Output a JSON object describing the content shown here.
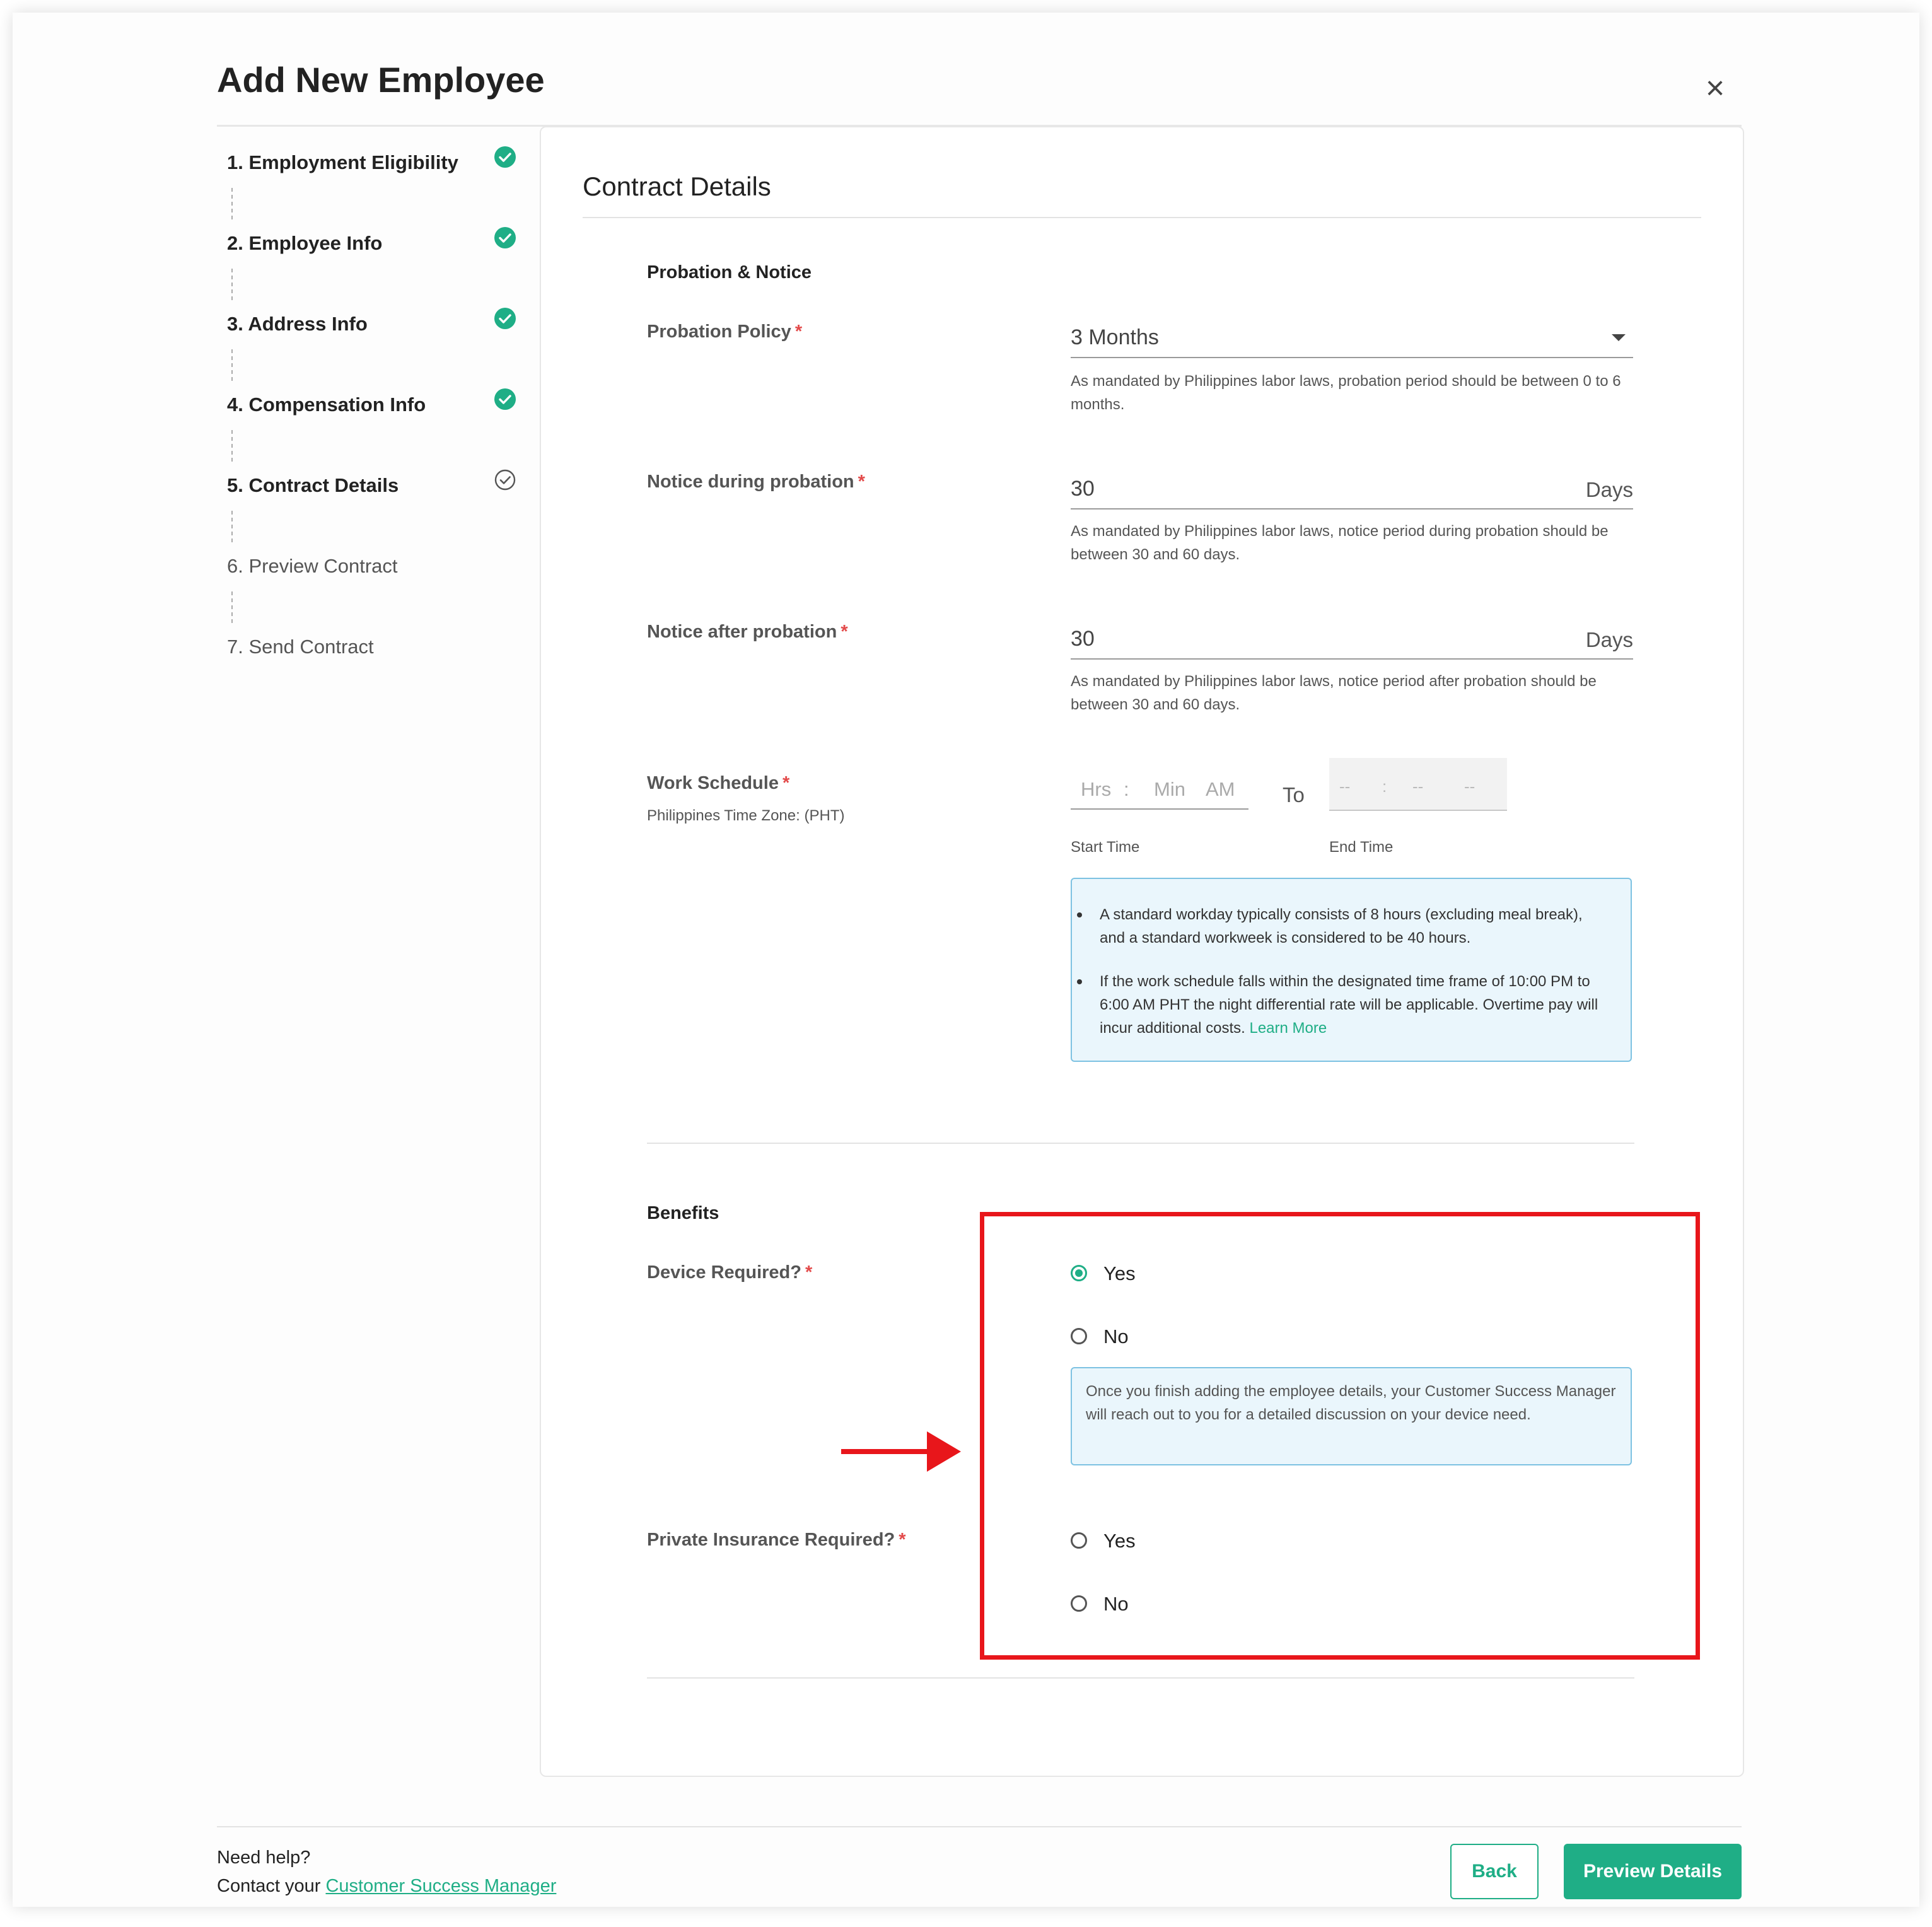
{
  "modal": {
    "title": "Add New Employee",
    "close_label": "×"
  },
  "steps": [
    {
      "label": "1. Employment Eligibility",
      "status": "done"
    },
    {
      "label": "2. Employee Info",
      "status": "done"
    },
    {
      "label": "3. Address Info",
      "status": "done"
    },
    {
      "label": "4. Compensation Info",
      "status": "done"
    },
    {
      "label": "5. Contract Details",
      "status": "current"
    },
    {
      "label": "6. Preview Contract",
      "status": "todo"
    },
    {
      "label": "7. Send Contract",
      "status": "todo"
    }
  ],
  "content": {
    "title": "Contract Details",
    "probation_section": "Probation & Notice",
    "probation_policy": {
      "label": "Probation Policy",
      "required": "*",
      "value": "3 Months",
      "help": "As mandated by Philippines labor laws, probation period should be between 0 to 6 months."
    },
    "notice_during": {
      "label": "Notice during probation",
      "required": "*",
      "value": "30",
      "unit": "Days",
      "help": "As mandated by Philippines labor laws, notice period during probation should be between 30 and 60 days."
    },
    "notice_after": {
      "label": "Notice after probation",
      "required": "*",
      "value": "30",
      "unit": "Days",
      "help": "As mandated by Philippines labor laws, notice period after probation should be between 30 and 60 days."
    },
    "work_schedule": {
      "label": "Work Schedule",
      "required": "*",
      "timezone": "Philippines Time Zone: (PHT)",
      "start_hrs": "Hrs",
      "start_sep": ":",
      "start_min": "Min",
      "start_ampm": "AM",
      "to": "To",
      "end_hrs": "--",
      "end_sep": ":",
      "end_min": "--",
      "end_ampm": "--",
      "start_caption": "Start Time",
      "end_caption": "End Time",
      "info_1": "A standard workday typically consists of 8 hours (excluding meal break), and a standard workweek is considered to be 40 hours.",
      "info_2": "If the work schedule falls within the designated time frame of 10:00 PM to 6:00 AM PHT the night differential rate will be applicable. Overtime pay will incur additional costs.",
      "learn_more": "Learn More"
    },
    "benefits_section": "Benefits",
    "device": {
      "label": "Device Required?",
      "required": "*",
      "options": [
        "Yes",
        "No"
      ],
      "selected": "Yes",
      "note": "Once you finish adding the employee details, your Customer Success Manager will reach out to you for a detailed discussion on your device need."
    },
    "insurance": {
      "label": "Private Insurance Required?",
      "required": "*",
      "options": [
        "Yes",
        "No"
      ],
      "selected": ""
    }
  },
  "footer": {
    "need_help": "Need help?",
    "contact_prefix": "Contact your ",
    "contact_link": "Customer Success Manager",
    "back": "Back",
    "preview": "Preview Details"
  },
  "colors": {
    "accent": "#1fae86",
    "required": "#e34a4a",
    "highlight": "#e8161b",
    "info_bg": "#eaf6fc",
    "info_border": "#7dc2e2"
  },
  "icons": {
    "close": "close-icon",
    "step_done": "check-circle-filled-icon",
    "step_current": "check-circle-outline-icon",
    "dropdown": "caret-down-icon",
    "annotation_arrow": "arrow-right-icon"
  }
}
